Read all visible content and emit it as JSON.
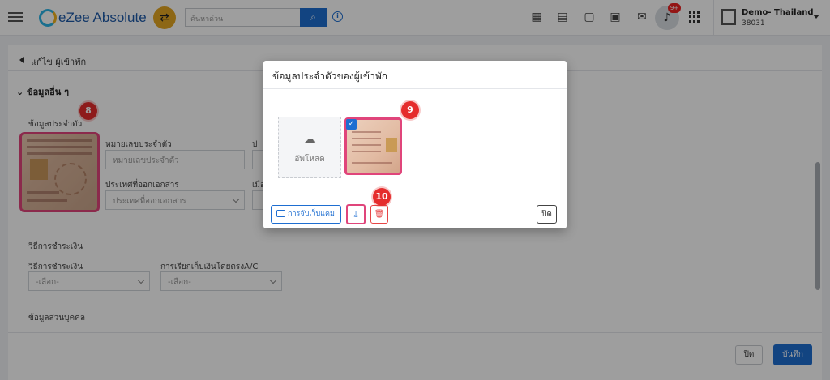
{
  "app": {
    "brand": "eZee Absolute"
  },
  "header": {
    "search_placeholder": "ค้นหาด่วน",
    "notification_count": "9+",
    "hotel_name": "Demo- Thailand",
    "hotel_code": "38031"
  },
  "page": {
    "back_label": "แก้ไข ผู้เข้าพัก",
    "section_title": "ข้อมูลอื่น ๆ",
    "identity": {
      "label": "ข้อมูลประจำตัว",
      "id_number_label": "หมายเลขประจำตัว",
      "id_number_placeholder": "หมายเลขประจำตัว",
      "issuing_country_label": "ประเทศที่ออกเอกสาร",
      "issuing_country_placeholder": "ประเทศที่ออกเอกสาร",
      "partial_label_1": "ป",
      "partial_label_2": "เมือ"
    },
    "payment": {
      "section_label": "วิธีการชำระเงิน",
      "method_label": "วิธีการชำระเงิน",
      "method_value": "-เลือก-",
      "billing_label": "การเรียกเก็บเงินโดยตรงA/C",
      "billing_value": "-เลือก-"
    },
    "personal_label": "ข้อมูลส่วนบุคคล",
    "footer": {
      "close_label": "ปิด",
      "save_label": "บันทึก"
    }
  },
  "modal": {
    "title": "ข้อมูลประจำตัวของผู้เข้าพัก",
    "upload_label": "อัพโหลด",
    "webcam_label": "การจับเว็บแคม",
    "close_label": "ปิด"
  },
  "steps": {
    "step8": "8",
    "step9": "9",
    "step10": "10"
  },
  "colors": {
    "primary": "#1e6ed1",
    "highlight": "#e0457b",
    "badge": "#e52d2d",
    "accent": "#e4a722"
  }
}
